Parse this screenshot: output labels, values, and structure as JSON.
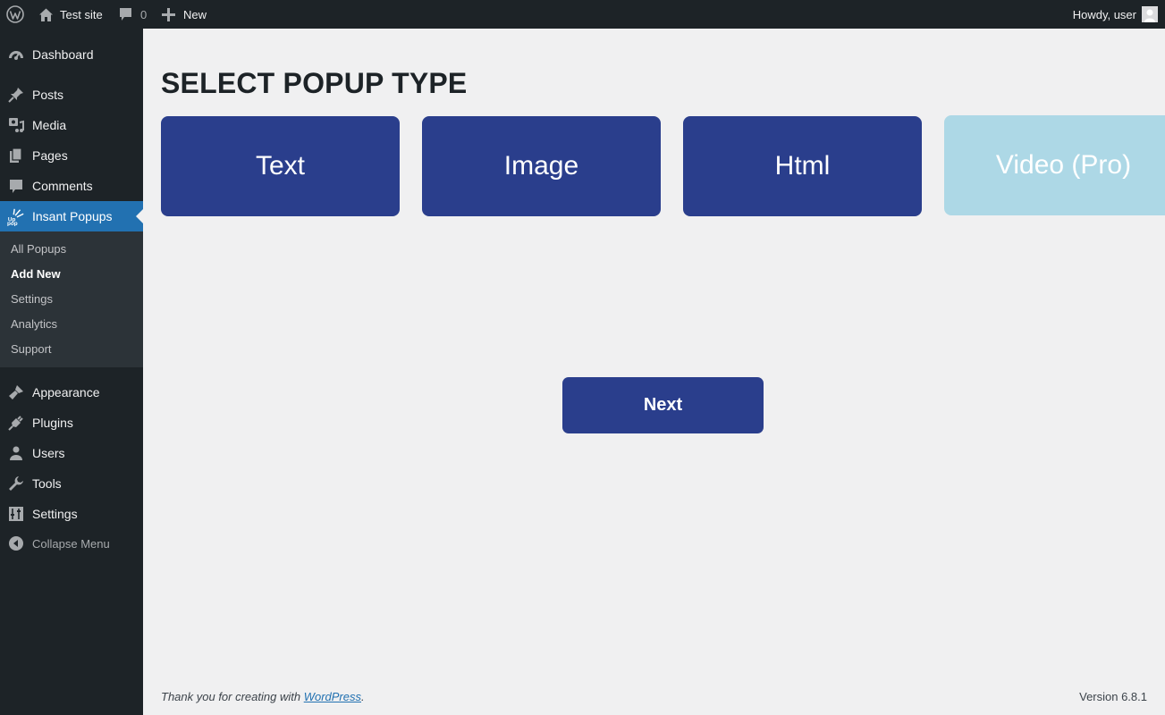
{
  "adminbar": {
    "site_name": "Test site",
    "comments_count": "0",
    "new_label": "New",
    "howdy": "Howdy, user"
  },
  "sidebar": {
    "items": [
      {
        "label": "Dashboard",
        "icon": "dashboard-icon"
      },
      {
        "label": "Posts",
        "icon": "pin-icon"
      },
      {
        "label": "Media",
        "icon": "media-icon"
      },
      {
        "label": "Pages",
        "icon": "pages-icon"
      },
      {
        "label": "Comments",
        "icon": "comment-icon"
      },
      {
        "label": "Insant Popups",
        "icon": "popup-plugin-icon",
        "current": true
      },
      {
        "label": "Appearance",
        "icon": "brush-icon"
      },
      {
        "label": "Plugins",
        "icon": "plug-icon"
      },
      {
        "label": "Users",
        "icon": "user-icon"
      },
      {
        "label": "Tools",
        "icon": "wrench-icon"
      },
      {
        "label": "Settings",
        "icon": "settings-icon"
      }
    ],
    "submenu": [
      {
        "label": "All Popups"
      },
      {
        "label": "Add New",
        "current": true
      },
      {
        "label": "Settings"
      },
      {
        "label": "Analytics"
      },
      {
        "label": "Support"
      }
    ],
    "collapse_label": "Collapse Menu"
  },
  "main": {
    "title": "SELECT POPUP TYPE",
    "types": [
      {
        "label": "Text",
        "pro": false
      },
      {
        "label": "Image",
        "pro": false
      },
      {
        "label": "Html",
        "pro": false
      },
      {
        "label": "Video (Pro)",
        "pro": true
      }
    ],
    "next_label": "Next"
  },
  "footer": {
    "thanks_prefix": "Thank you for creating with ",
    "link_text": "WordPress",
    "thanks_suffix": ".",
    "version": "Version 6.8.1"
  },
  "colors": {
    "admin_dark": "#1d2327",
    "accent_blue": "#2271b1",
    "card_blue": "#2a3e8c",
    "card_pro": "#add8e6"
  }
}
